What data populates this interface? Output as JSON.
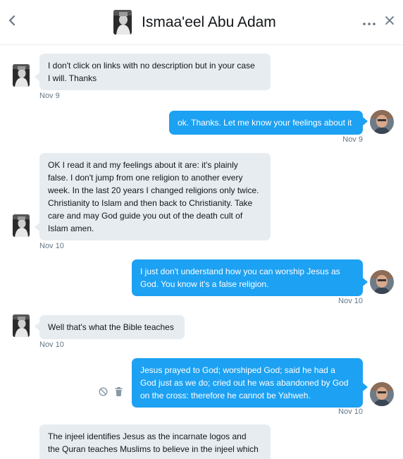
{
  "header": {
    "title": "Ismaa'eel Abu Adam",
    "back_icon": "chevron-left-icon",
    "more_icon": "ellipsis-icon",
    "close_icon": "close-icon"
  },
  "colors": {
    "accent": "#1da1f2",
    "incoming_bubble": "#e6ecf0",
    "timestamp": "#657786"
  },
  "messages": [
    {
      "direction": "in",
      "lines": [
        "I don't click on links with no description but in your case",
        "I will. Thanks"
      ],
      "timestamp": "Nov 9"
    },
    {
      "direction": "out",
      "lines": [
        "ok. Thanks. Let me know your feelings about it"
      ],
      "timestamp": "Nov 9"
    },
    {
      "direction": "in",
      "lines": [
        "OK I read it and my feelings about it are: it's plainly",
        "false.  I don't jump from one religion to another every",
        "week. In the last 20 years I changed religions only twice.",
        "Christianity to Islam and then back to Christianity.  Take",
        "care and may God guide you out of the death cult of",
        "Islam amen."
      ],
      "timestamp": "Nov 10"
    },
    {
      "direction": "out",
      "lines": [
        "I just don't understand how you can worship Jesus as",
        "God. You know it's a false religion."
      ],
      "timestamp": "Nov 10"
    },
    {
      "direction": "in",
      "lines": [
        "Well that's what the Bible teaches"
      ],
      "timestamp": "Nov 10"
    },
    {
      "direction": "out",
      "lines": [
        "Jesus prayed to God; worshiped God; said he had a",
        "God just as we do; cried out he was abandoned by God",
        "on the cross: therefore he cannot be Yahweh."
      ],
      "timestamp": "Nov 10"
    },
    {
      "direction": "in",
      "lines": [
        "The injeel  identifies Jesus as the incarnate logos and",
        "the Quran teaches Muslims to believe in the injeel which"
      ],
      "timestamp": ""
    }
  ]
}
